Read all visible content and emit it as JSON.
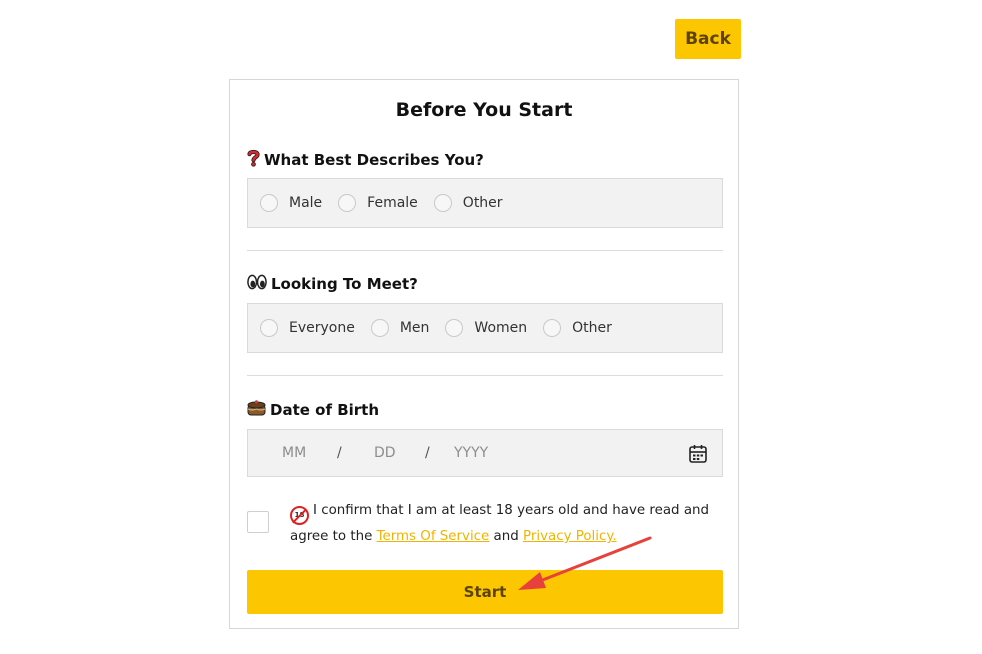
{
  "header": {
    "back_label": "Back"
  },
  "form": {
    "title": "Before You Start",
    "describes": {
      "icon": "question-mark-icon",
      "label": "What Best Describes You?",
      "options": [
        "Male",
        "Female",
        "Other"
      ]
    },
    "looking": {
      "icon": "eyes-icon",
      "label": "Looking To Meet?",
      "options": [
        "Everyone",
        "Men",
        "Women",
        "Other"
      ]
    },
    "dob": {
      "icon": "cake-icon",
      "label": "Date of Birth",
      "mm_placeholder": "MM",
      "dd_placeholder": "DD",
      "yyyy_placeholder": "YYYY",
      "separator": "/"
    },
    "confirm": {
      "icon": "no-under-18-icon",
      "text_before": "I confirm that I am at least 18 years old and have read and agree to the",
      "terms_link": "Terms Of Service",
      "and": "and",
      "privacy_link": "Privacy Policy."
    },
    "start_label": "Start"
  },
  "colors": {
    "accent": "#fcc700",
    "accent_text": "#5c4300",
    "link": "#f0b400",
    "annotation_arrow": "#e8413c"
  }
}
